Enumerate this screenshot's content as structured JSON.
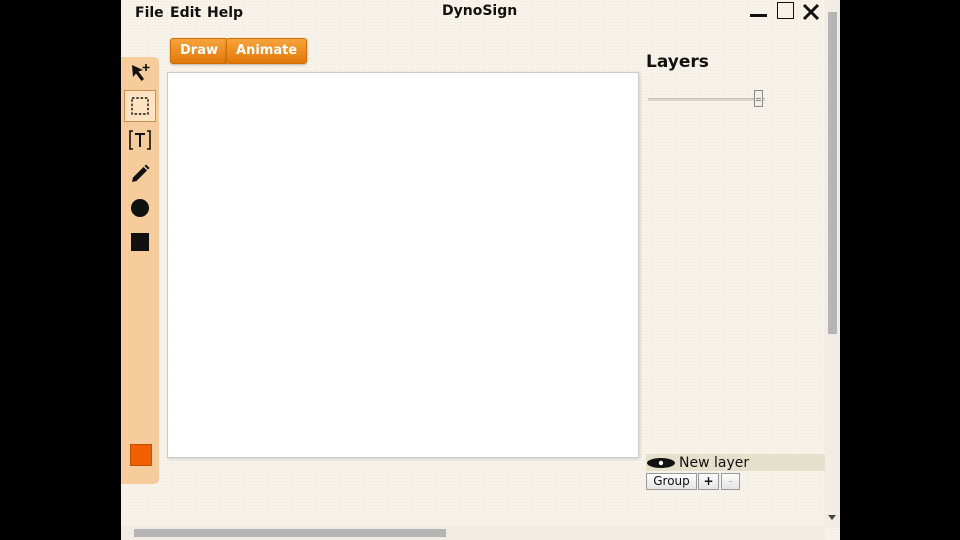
{
  "menu": {
    "file": "File",
    "edit": "Edit",
    "help": "Help"
  },
  "window": {
    "title": "DynoSign"
  },
  "modes": {
    "draw": "Draw",
    "animate": "Animate"
  },
  "tools": [
    {
      "name": "select-pointer-icon",
      "active": false
    },
    {
      "name": "marquee-select-icon",
      "active": true
    },
    {
      "name": "text-tool-icon",
      "active": false
    },
    {
      "name": "pencil-icon",
      "active": false
    },
    {
      "name": "circle-icon",
      "active": false
    },
    {
      "name": "square-icon",
      "active": false
    }
  ],
  "current_color": "#f06000",
  "accent_color": "#e8810f",
  "layers": {
    "title": "Layers",
    "opacity_slider_value": 0.94,
    "items": [
      {
        "name": "New layer",
        "visible": true
      }
    ],
    "buttons": {
      "group": "Group",
      "add": "+",
      "remove": "-"
    }
  }
}
